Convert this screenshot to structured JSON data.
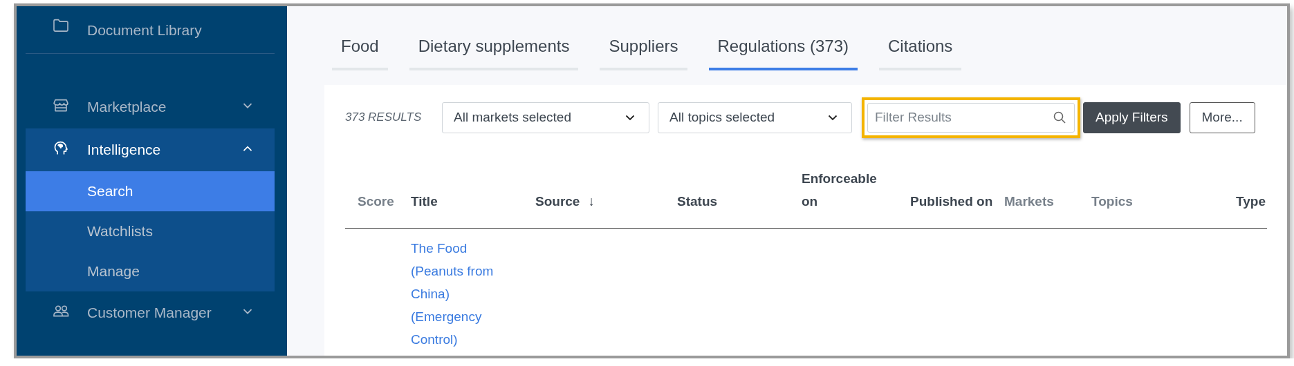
{
  "sidebar": {
    "items": [
      {
        "label": "Document Library"
      },
      {
        "kind": "divider"
      },
      {
        "label": "Marketplace",
        "expanded": false
      },
      {
        "label": "Intelligence",
        "expanded": true,
        "children": [
          {
            "label": "Search",
            "selected": true
          },
          {
            "label": "Watchlists",
            "selected": false
          },
          {
            "label": "Manage",
            "selected": false
          }
        ]
      },
      {
        "label": "Customer Manager",
        "expanded": false
      }
    ]
  },
  "tabs": [
    {
      "label": "Food",
      "selected": false
    },
    {
      "label": "Dietary supplements",
      "selected": false
    },
    {
      "label": "Suppliers",
      "selected": false
    },
    {
      "label": "Regulations (373)",
      "selected": true
    },
    {
      "label": "Citations",
      "selected": false
    }
  ],
  "filters": {
    "results_count": "373 RESULTS",
    "dropdowns": [
      {
        "value": "All markets selected"
      },
      {
        "value": "All topics selected"
      }
    ],
    "search": {
      "placeholder": "Filter Results",
      "highlighted": true
    },
    "buttons": [
      {
        "label": "Apply Filters",
        "kind": "primary"
      },
      {
        "label": "More...",
        "kind": "outline"
      }
    ]
  },
  "table": {
    "columns": [
      {
        "label": "Score",
        "muted": true
      },
      {
        "label": "Title",
        "muted": false
      },
      {
        "label": "Source",
        "muted": false,
        "sort_indicator": "↓"
      },
      {
        "label": "Status",
        "muted": false
      },
      {
        "label": "Enforceable on",
        "muted": false
      },
      {
        "label": "Published on",
        "muted": false
      },
      {
        "label": "Markets",
        "muted": true
      },
      {
        "label": "Topics",
        "muted": true
      },
      {
        "label": "Type",
        "muted": false
      }
    ],
    "rows": [
      {
        "title": "The Food (Peanuts from China) (Emergency Control)"
      }
    ]
  }
}
